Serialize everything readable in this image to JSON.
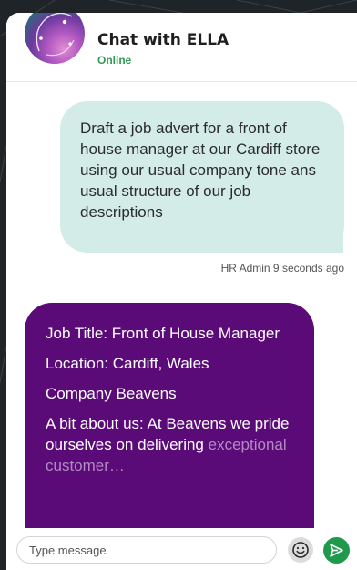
{
  "header": {
    "title": "Chat with ELLA",
    "status": "Online",
    "status_color": "#2e9b52"
  },
  "messages": {
    "user": {
      "text": "Draft a job advert for a front of house manager at our Cardiff store using our usual company tone ans usual structure of our job descriptions",
      "meta": "HR Admin 9 seconds ago"
    },
    "bot": {
      "lines": [
        "Job Title: Front of House Manager",
        "Location: Cardiff, Wales",
        "Company Beavens",
        "A bit about us: At Beavens we pride ourselves on delivering"
      ],
      "fade_line": "exceptional customer…"
    }
  },
  "composer": {
    "placeholder": "Type message",
    "emoji_icon": "smiley-icon",
    "send_icon": "send-icon"
  },
  "colors": {
    "user_bubble": "#d3ece8",
    "bot_bubble": "#5a0b78",
    "send_button": "#1f9a4c",
    "background": "#1f2428"
  }
}
